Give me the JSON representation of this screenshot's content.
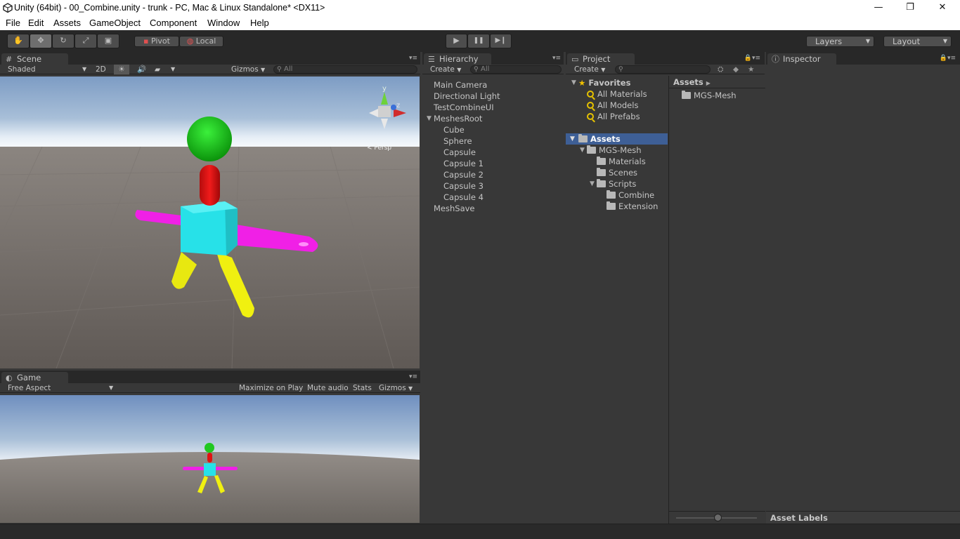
{
  "window": {
    "title": "Unity (64bit) - 00_Combine.unity - trunk - PC, Mac & Linux Standalone* <DX11>",
    "controls": {
      "minimize": "—",
      "restore": "❐",
      "close": "✕"
    }
  },
  "menu": [
    "File",
    "Edit",
    "Assets",
    "GameObject",
    "Component",
    "Window",
    "Help"
  ],
  "toolbar": {
    "tools": [
      {
        "name": "hand-tool",
        "icon": "✋"
      },
      {
        "name": "move-tool",
        "icon": "✥"
      },
      {
        "name": "rotate-tool",
        "icon": "↻"
      },
      {
        "name": "scale-tool",
        "icon": "⤢"
      },
      {
        "name": "rect-tool",
        "icon": "▣"
      }
    ],
    "pivot_label": "Pivot",
    "local_label": "Local",
    "play_icon": "▶",
    "pause_icon": "❚❚",
    "step_icon": "▶❙",
    "layers_label": "Layers",
    "layout_label": "Layout"
  },
  "scene": {
    "tab_label": "Scene",
    "shading": "Shaded",
    "mode_2d": "2D",
    "gizmos": "Gizmos",
    "search_placeholder": "All",
    "gizmo_axis_y": "y",
    "gizmo_axis_z": "z",
    "gizmo_persp": "< Persp"
  },
  "game": {
    "tab_label": "Game",
    "aspect": "Free Aspect",
    "maximize": "Maximize on Play",
    "mute": "Mute audio",
    "stats": "Stats",
    "gizmos": "Gizmos"
  },
  "hierarchy": {
    "tab_label": "Hierarchy",
    "create": "Create",
    "search_placeholder": "All",
    "items": [
      {
        "label": "Main Camera",
        "depth": 0
      },
      {
        "label": "Directional Light",
        "depth": 0
      },
      {
        "label": "TestCombineUI",
        "depth": 0
      },
      {
        "label": "MeshesRoot",
        "depth": 0,
        "expanded": true
      },
      {
        "label": "Cube",
        "depth": 1
      },
      {
        "label": "Sphere",
        "depth": 1
      },
      {
        "label": "Capsule",
        "depth": 1
      },
      {
        "label": "Capsule 1",
        "depth": 1
      },
      {
        "label": "Capsule 2",
        "depth": 1
      },
      {
        "label": "Capsule 3",
        "depth": 1
      },
      {
        "label": "Capsule 4",
        "depth": 1
      },
      {
        "label": "MeshSave",
        "depth": 0
      }
    ]
  },
  "project": {
    "tab_label": "Project",
    "create": "Create",
    "favorites_label": "Favorites",
    "favorites": [
      "All Materials",
      "All Models",
      "All Prefabs"
    ],
    "assets_label": "Assets",
    "tree": [
      {
        "label": "MGS-Mesh",
        "depth": 1,
        "expanded": true
      },
      {
        "label": "Materials",
        "depth": 2
      },
      {
        "label": "Scenes",
        "depth": 2
      },
      {
        "label": "Scripts",
        "depth": 2,
        "expanded": true
      },
      {
        "label": "Combine",
        "depth": 3
      },
      {
        "label": "Extension",
        "depth": 3
      }
    ],
    "breadcrumb": "Assets",
    "grid_items": [
      "MGS-Mesh"
    ],
    "asset_labels": "Asset Labels"
  },
  "inspector": {
    "tab_label": "Inspector"
  },
  "colors": {
    "editor_bg": "#383838",
    "toolbar_bg": "#282828",
    "selection": "#3e5f96",
    "body_cyan": "#27e1e8",
    "head_green": "#21c821",
    "neck_red": "#e01212",
    "arms_magenta": "#f020e6",
    "legs_yellow": "#f0f010"
  }
}
